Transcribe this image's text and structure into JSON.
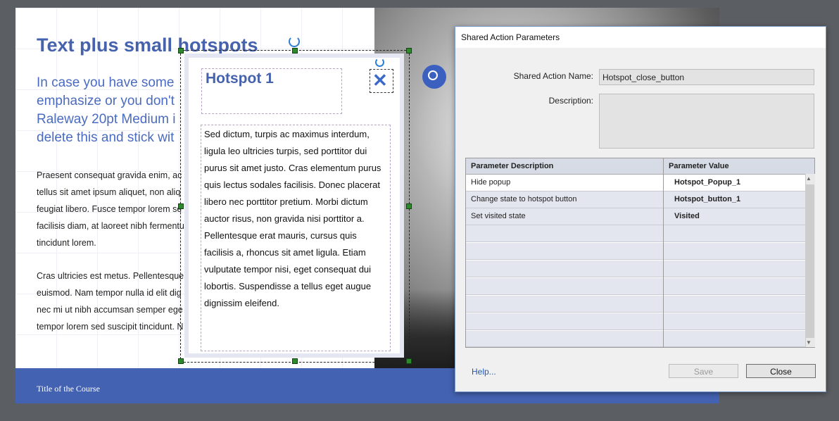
{
  "slide": {
    "title": "Text plus small hotspots",
    "subtitle_lines": [
      "In case you have some",
      "emphasize or you don't",
      "Raleway 20pt Medium i",
      "delete this and stick wit"
    ],
    "paragraph1_lines": [
      "Praesent consequat gravida enim, ac",
      "tellus sit amet ipsum aliquet, non aliq",
      "feugiat libero. Fusce tempor lorem se",
      "facilisis diam, at laoreet nibh fermentu",
      "tincidunt lorem."
    ],
    "paragraph2_lines": [
      "Cras ultricies est metus. Pellentesque",
      "euismod. Nam tempor nulla id elit dig",
      "nec mi ut nibh accumsan semper ege",
      "tempor lorem sed suscipit tincidunt. N"
    ],
    "course_title": "Title of the Course"
  },
  "popup": {
    "title": "Hotspot 1",
    "close_icon": "close-x-icon",
    "body_lines": [
      "Sed dictum, turpis ac maximus interdum,",
      "ligula leo ultricies turpis, sed porttitor dui",
      "purus sit amet justo. Cras elementum purus",
      "quis lectus sodales facilisis. Donec placerat",
      "libero nec porttitor pretium. Morbi dictum",
      "auctor risus, non gravida nisi porttitor a.",
      "Pellentesque erat mauris, cursus quis",
      "facilisis a, rhoncus sit amet ligula. Etiam",
      "vulputate tempor nisi, eget consequat dui",
      "lobortis. Suspendisse a tellus eget augue",
      "dignissim eleifend."
    ]
  },
  "dialog": {
    "title": "Shared Action Parameters",
    "name_label": "Shared Action Name:",
    "name_value": "Hotspot_close_button",
    "description_label": "Description:",
    "description_value": "",
    "table": {
      "headers": [
        "Parameter Description",
        "Parameter Value"
      ],
      "rows": [
        {
          "description": "Hide popup",
          "value": "Hotspot_Popup_1"
        },
        {
          "description": "Change state to hotspot button",
          "value": "Hotspot_button_1"
        },
        {
          "description": "Set visited state",
          "value": "Visited"
        }
      ]
    },
    "help_label": "Help...",
    "save_label": "Save",
    "close_label": "Close"
  },
  "colors": {
    "accent": "#4762ad",
    "footer": "#4462b2"
  }
}
